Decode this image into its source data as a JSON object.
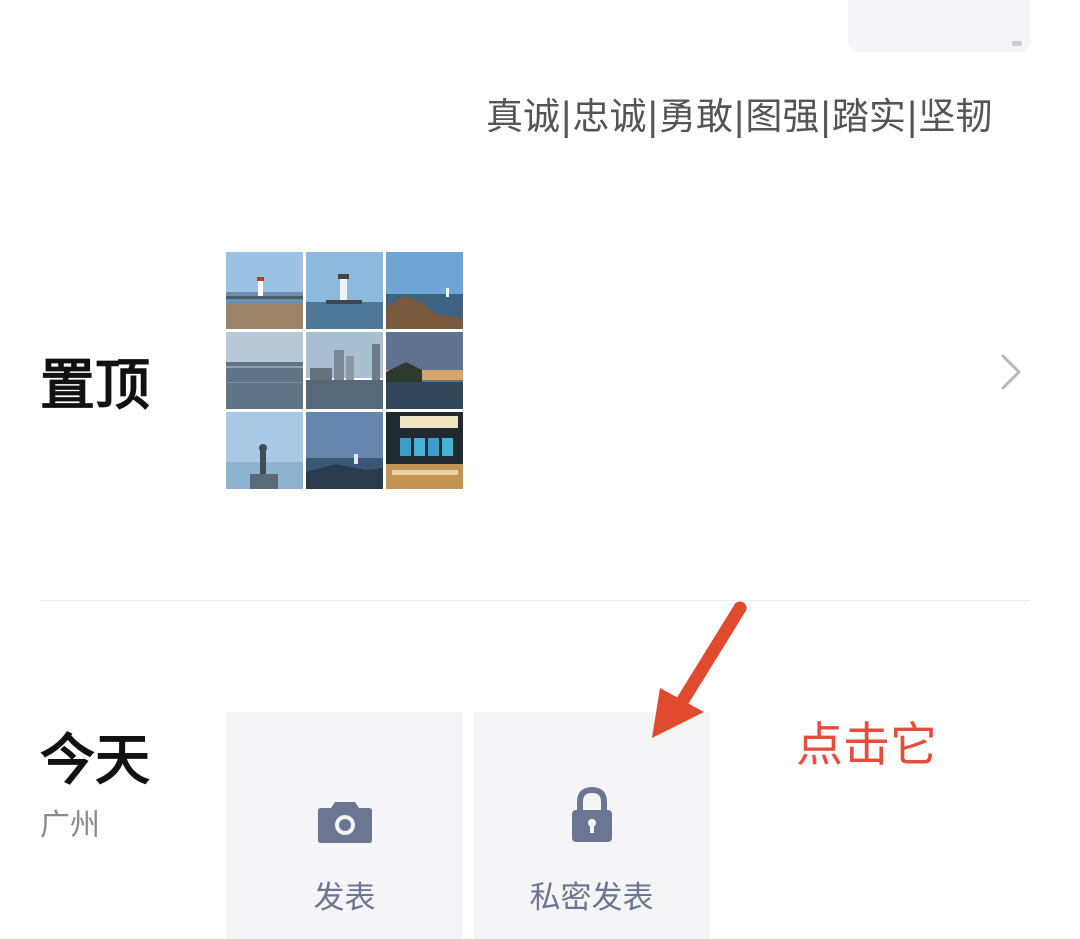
{
  "profile": {
    "signature": "真诚|忠诚|勇敢|图强|踏实|坚韧"
  },
  "pinned": {
    "label": "置顶",
    "photos": [
      "photo-lighthouse-beach",
      "photo-lighthouse-pier",
      "photo-rocky-coast",
      "photo-sea-horizon",
      "photo-city-skyline",
      "photo-sunset-bay",
      "photo-statue-sea",
      "photo-coastal-dusk",
      "photo-shop-interior"
    ]
  },
  "today": {
    "label": "今天",
    "location": "广州",
    "post_label": "发表",
    "private_post_label": "私密发表"
  },
  "annotation": {
    "hint": "点击它",
    "color": "#e74c3c"
  },
  "icons": {
    "camera": "camera-icon",
    "lock": "lock-icon",
    "chevron": "chevron-right-icon"
  },
  "colors": {
    "icon_color": "#6b7694",
    "button_bg": "#f5f5f7",
    "accent_red": "#e74c3c"
  }
}
